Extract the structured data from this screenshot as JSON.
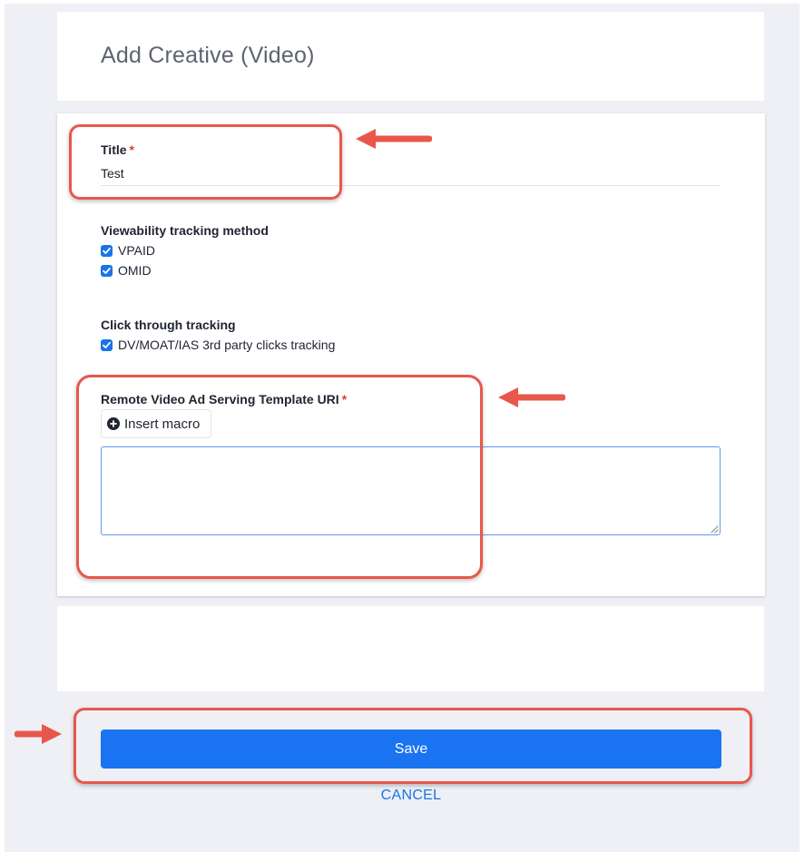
{
  "header": {
    "title": "Add Creative (Video)"
  },
  "form": {
    "title_field": {
      "label": "Title",
      "required_mark": "*",
      "value": "Test"
    },
    "viewability": {
      "label": "Viewability tracking method",
      "options": [
        {
          "label": "VPAID",
          "checked": true
        },
        {
          "label": "OMID",
          "checked": true
        }
      ]
    },
    "click_through": {
      "label": "Click through tracking",
      "options": [
        {
          "label": "DV/MOAT/IAS 3rd party clicks tracking",
          "checked": true
        }
      ]
    },
    "vast_uri": {
      "label": "Remote Video Ad Serving Template URI",
      "required_mark": "*",
      "insert_macro_label": "Insert macro",
      "value": ""
    }
  },
  "actions": {
    "save_label": "Save",
    "cancel_label": "CANCEL"
  },
  "colors": {
    "accent": "#1a73e8",
    "annotation": "#e8574a",
    "page_background": "#eef0f5",
    "required": "#e03a3a"
  },
  "annotations": {
    "highlighted": [
      "title-field",
      "vast-uri-field",
      "save-button"
    ]
  }
}
